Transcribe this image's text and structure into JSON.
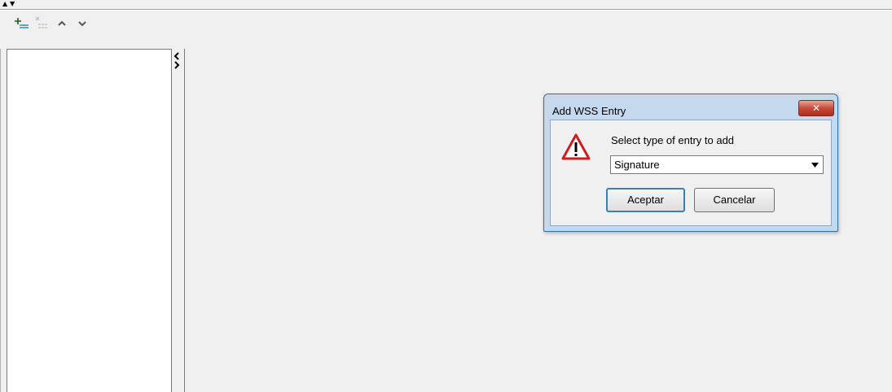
{
  "top_strip": {
    "collapse_up_icon": "▲",
    "collapse_down_icon": "▼"
  },
  "toolbar": {
    "items": [
      {
        "name": "add-entry-icon",
        "enabled": true
      },
      {
        "name": "remove-entry-icon",
        "enabled": false
      },
      {
        "name": "move-up-icon",
        "enabled": true,
        "glyph": "⌃"
      },
      {
        "name": "move-down-icon",
        "enabled": true,
        "glyph": "⌄"
      }
    ]
  },
  "splitter": {
    "left_arrow": "‹",
    "right_arrow": "›"
  },
  "dialog": {
    "title": "Add WSS Entry",
    "close_label": "✕",
    "message": "Select type of entry to add",
    "select": {
      "value": "Signature"
    },
    "ok_label": "Aceptar",
    "cancel_label": "Cancelar",
    "icon": "warning-icon"
  },
  "colors": {
    "dialog_frame": "#c5d9ee",
    "close_button": "#c64b3a",
    "default_button_border": "#3c7fb1",
    "warning_red": "#cc1e1e"
  }
}
